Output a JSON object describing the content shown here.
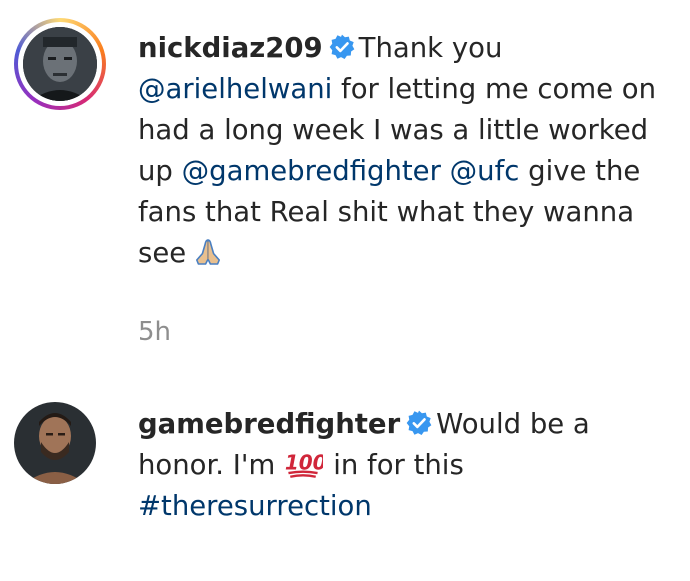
{
  "comments": [
    {
      "username": "nickdiaz209",
      "verified": true,
      "line1": "Thank you",
      "mention1": "@arielhelwani",
      "line2": " for letting me come on",
      "line3": "had a long week I was a little worked",
      "line4a": "up ",
      "mention2": "@gamebredfighter",
      "line4b": " ",
      "mention3": "@ufc",
      "line4c": " give the",
      "line5": "fans that Real shit what they wanna",
      "line6": "see",
      "emoji": "praying-hands-icon",
      "time": "5h"
    },
    {
      "username": "gamebredfighter",
      "verified": true,
      "line1": "Would be a",
      "line2a": "honor. I'm",
      "emoji": "hundred-points-icon",
      "line2b": "in for this",
      "hashtag": "#theresurrection"
    }
  ],
  "colors": {
    "text": "#262626",
    "link": "#00376b",
    "verified_blue": "#3897f0",
    "meta": "#8e8e8e"
  }
}
